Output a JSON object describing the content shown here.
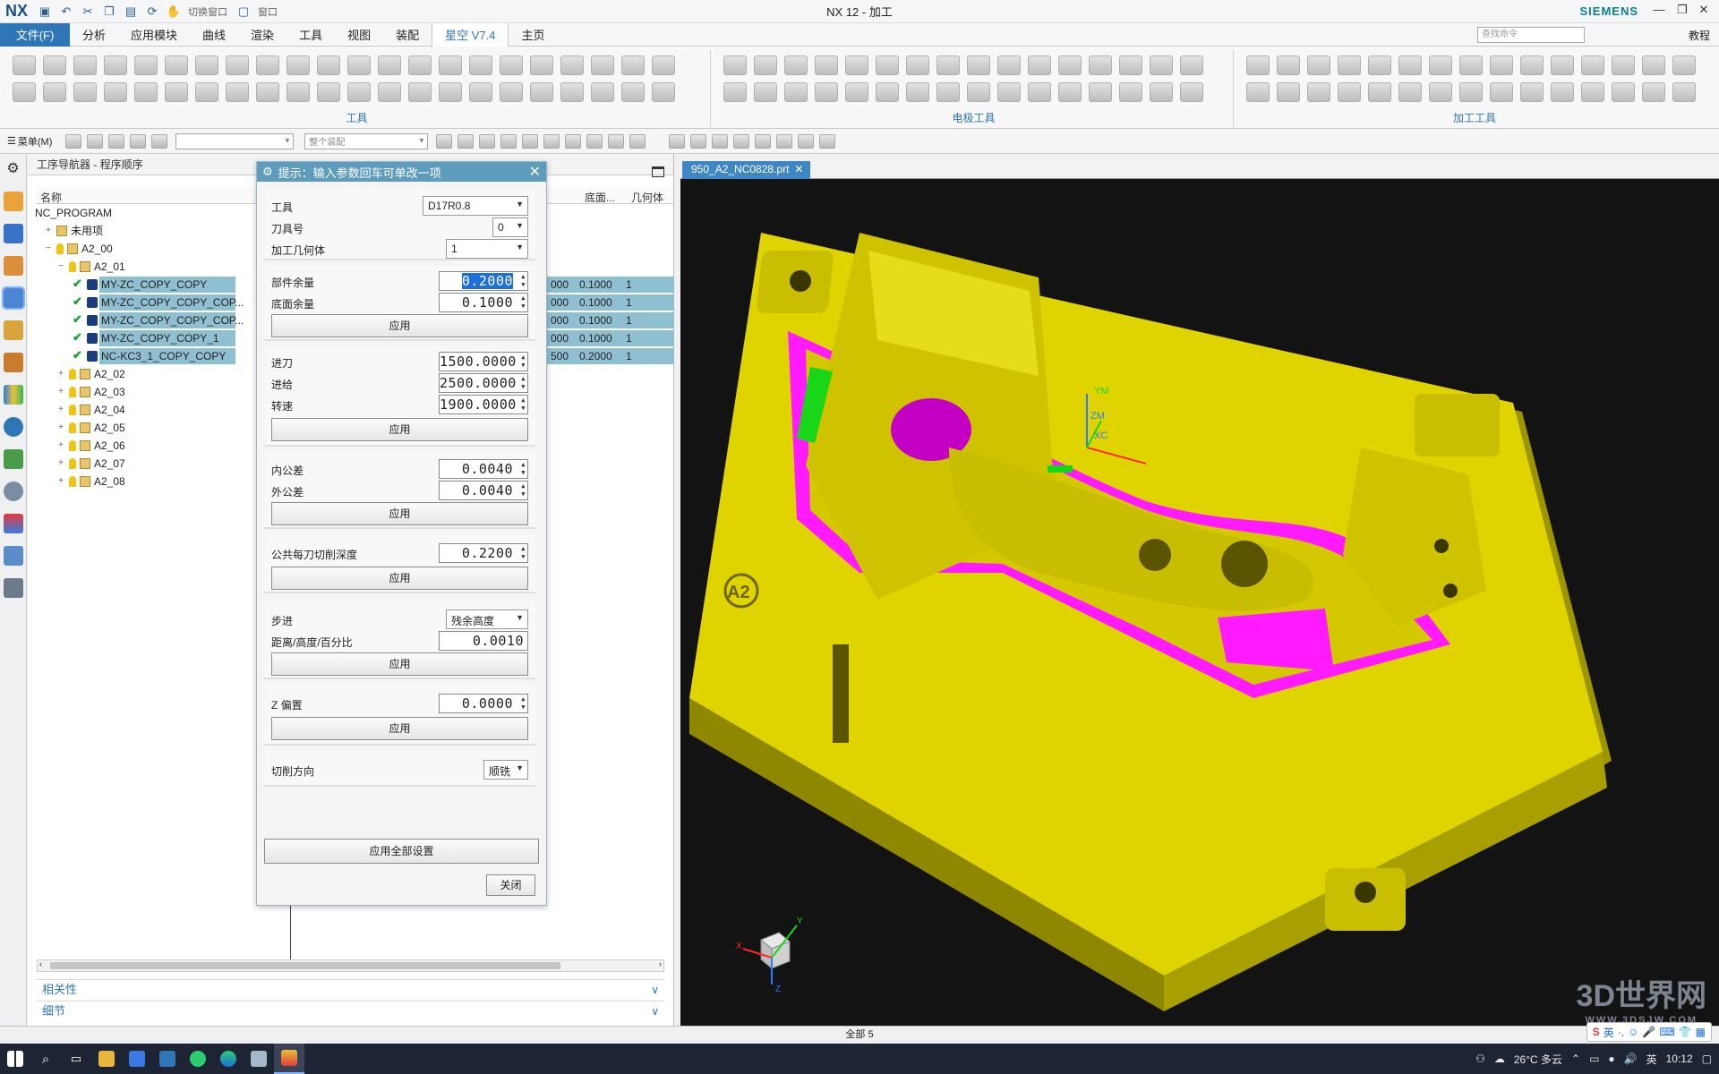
{
  "titlebar": {
    "logo": "NX",
    "window_menu": "窗口",
    "switch_window": "切换窗口",
    "title": "NX 12 - 加工",
    "brand": "SIEMENS"
  },
  "menubar": {
    "file": "文件(F)",
    "items": [
      "分析",
      "应用模块",
      "曲线",
      "渲染",
      "工具",
      "视图",
      "装配",
      "星空 V7.4",
      "主页"
    ],
    "active_index": 7,
    "search_placeholder": "查找命令",
    "help": "教程"
  },
  "ribbon": {
    "groups": [
      "工具",
      "电极工具",
      "加工工具"
    ]
  },
  "toolbar2": {
    "menu": "菜单(M)",
    "filter_select": "",
    "assembly_select": "整个装配"
  },
  "navigator": {
    "title": "工序导航器 - 程序顺序",
    "columns": [
      "名称",
      "底面...",
      "几何体"
    ],
    "rows": [
      {
        "name": "NC_PROGRAM",
        "level": 0,
        "toggle": "",
        "icon": "none",
        "col_a": "",
        "col_b": "",
        "col_c": "",
        "selected": false
      },
      {
        "name": "未用项",
        "level": 1,
        "toggle": "+",
        "icon": "folder",
        "col_a": "",
        "col_b": "",
        "col_c": "",
        "selected": false
      },
      {
        "name": "A2_00",
        "level": 1,
        "toggle": "−",
        "icon": "key-folder",
        "col_a": "",
        "col_b": "",
        "col_c": "",
        "selected": false
      },
      {
        "name": "A2_01",
        "level": 2,
        "toggle": "−",
        "icon": "key-folder",
        "col_a": "",
        "col_b": "",
        "col_c": "",
        "selected": false
      },
      {
        "name": "MY-ZC_COPY_COPY",
        "level": 3,
        "toggle": "",
        "icon": "op",
        "col_a": "000",
        "col_b": "0.1000",
        "col_c": "1",
        "selected": true
      },
      {
        "name": "MY-ZC_COPY_COPY_COP...",
        "level": 3,
        "toggle": "",
        "icon": "op",
        "col_a": "000",
        "col_b": "0.1000",
        "col_c": "1",
        "selected": true
      },
      {
        "name": "MY-ZC_COPY_COPY_COP...",
        "level": 3,
        "toggle": "",
        "icon": "op",
        "col_a": "000",
        "col_b": "0.1000",
        "col_c": "1",
        "selected": true
      },
      {
        "name": "MY-ZC_COPY_COPY_1",
        "level": 3,
        "toggle": "",
        "icon": "op",
        "col_a": "000",
        "col_b": "0.1000",
        "col_c": "1",
        "selected": true
      },
      {
        "name": "NC-KC3_1_COPY_COPY",
        "level": 3,
        "toggle": "",
        "icon": "op",
        "col_a": "500",
        "col_b": "0.2000",
        "col_c": "1",
        "selected": true
      },
      {
        "name": "A2_02",
        "level": 2,
        "toggle": "+",
        "icon": "key-folder",
        "col_a": "",
        "col_b": "",
        "col_c": "",
        "selected": false
      },
      {
        "name": "A2_03",
        "level": 2,
        "toggle": "+",
        "icon": "key-folder",
        "col_a": "",
        "col_b": "",
        "col_c": "",
        "selected": false
      },
      {
        "name": "A2_04",
        "level": 2,
        "toggle": "+",
        "icon": "key-folder",
        "col_a": "",
        "col_b": "",
        "col_c": "",
        "selected": false
      },
      {
        "name": "A2_05",
        "level": 2,
        "toggle": "+",
        "icon": "key-folder",
        "col_a": "",
        "col_b": "",
        "col_c": "",
        "selected": false
      },
      {
        "name": "A2_06",
        "level": 2,
        "toggle": "+",
        "icon": "key-folder",
        "col_a": "",
        "col_b": "",
        "col_c": "",
        "selected": false
      },
      {
        "name": "A2_07",
        "level": 2,
        "toggle": "+",
        "icon": "key-folder",
        "col_a": "",
        "col_b": "",
        "col_c": "",
        "selected": false
      },
      {
        "name": "A2_08",
        "level": 2,
        "toggle": "+",
        "icon": "key-folder",
        "col_a": "",
        "col_b": "",
        "col_c": "",
        "selected": false
      }
    ],
    "sections": [
      "相关性",
      "细节"
    ]
  },
  "dialog": {
    "title": "提示：输入参数回车可单改一项",
    "tool_label": "工具",
    "tool_value": "D17R0.8",
    "tool_number_label": "刀具号",
    "tool_number_value": "0",
    "geometry_label": "加工几何体",
    "geometry_value": "1",
    "part_stock_label": "部件余量",
    "part_stock_value": "0.2000",
    "floor_stock_label": "底面余量",
    "floor_stock_value": "0.1000",
    "engage_label": "进刀",
    "engage_value": "1500.0000",
    "feed_label": "进给",
    "feed_value": "2500.0000",
    "speed_label": "转速",
    "speed_value": "1900.0000",
    "intol_label": "内公差",
    "intol_value": "0.0040",
    "outtol_label": "外公差",
    "outtol_value": "0.0040",
    "depth_label": "公共每刀切削深度",
    "depth_value": "0.2200",
    "stepover_label": "步进",
    "stepover_value": "残余高度",
    "distance_label": "距离/高度/百分比",
    "distance_value": "0.0010",
    "zoffset_label": "Z 偏置",
    "zoffset_value": "0.0000",
    "direction_label": "切削方向",
    "direction_value": "顺铣",
    "apply": "应用",
    "apply_all": "应用全部设置",
    "close": "关闭"
  },
  "viewport": {
    "tab": "950_A2_NC0828.prt",
    "part_mark": "A2",
    "wcs_labels": [
      "YM",
      "ZM",
      "XC"
    ],
    "triad_labels": [
      "X",
      "Y",
      "Z"
    ],
    "watermark": "3D世界网",
    "watermark_url": "WWW.3DSJW.COM",
    "colors": {
      "background": "#131313",
      "part": "#e0d400",
      "selected_face": "#ff1aff",
      "green_face": "#18d718"
    }
  },
  "statusbar": {
    "text": "全部 5"
  },
  "taskbar": {
    "weather": "26°C 多云",
    "lang": "英",
    "time": "10:12"
  },
  "ime": {
    "label": "英"
  }
}
